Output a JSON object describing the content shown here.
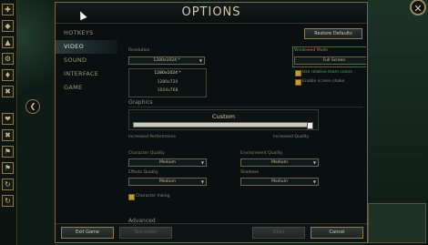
{
  "dialog": {
    "title": "OPTIONS",
    "close_glyph": "✕",
    "collapse_glyph": "❮"
  },
  "nav": [
    "HOTKEYS",
    "VIDEO",
    "SOUND",
    "INTERFACE",
    "GAME"
  ],
  "restore_defaults": "Restore Defaults",
  "resolution": {
    "label": "Resolution",
    "value": "1280x1024 *",
    "options": [
      "1280x1024 *",
      "1280x720",
      "1024x768"
    ]
  },
  "window_mode": {
    "label": "Windowed Mode",
    "value": "Full Screen"
  },
  "checkboxes": {
    "relative_team_colors": "Use relative team colors",
    "screen_shake": "Enable screen shake",
    "character_inking": "Character Inking"
  },
  "graphics": {
    "heading": "Graphics",
    "preset": "Custom",
    "slider_left": "Increased Performance",
    "slider_right": "Increased Quality",
    "slider_value_percent": 100
  },
  "quality": {
    "character": {
      "label": "Character Quality",
      "value": "Medium"
    },
    "environment": {
      "label": "Environment Quality",
      "value": "Medium"
    },
    "effects": {
      "label": "Effects Quality",
      "value": "Medium"
    },
    "shadows": {
      "label": "Shadows",
      "value": "Medium"
    }
  },
  "advanced_heading": "Advanced",
  "footer": {
    "exit": "Exit Game",
    "surrender": "Surrender",
    "okay": "Okay",
    "cancel": "Cancel"
  },
  "dropdown_arrow": "▼",
  "left_icons": [
    "✚",
    "◆",
    "▲",
    "⚙",
    "♦",
    "✖",
    "❤",
    "✖",
    "⚑",
    "⚑",
    "↻",
    "↻"
  ]
}
